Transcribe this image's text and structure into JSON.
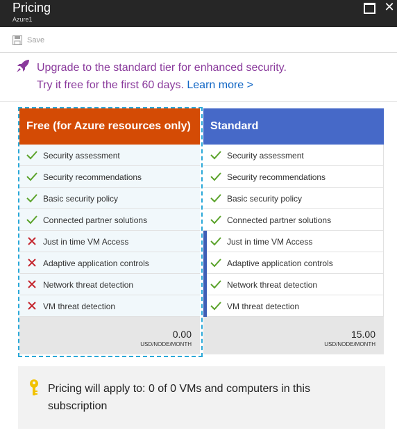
{
  "window": {
    "title": "Pricing",
    "subtitle": "Azure1"
  },
  "toolbar": {
    "save_label": "Save"
  },
  "banner": {
    "line1": "Upgrade to the standard tier for enhanced security.",
    "line2": "Try it free for the first 60 days.",
    "learn_more": "Learn more >",
    "accent_color": "#8a3a9c",
    "link_color": "#0f65c4"
  },
  "tiers": {
    "free": {
      "name": "Free (for Azure resources only)",
      "color": "#d44b05",
      "selected": true,
      "features": [
        {
          "label": "Security assessment",
          "included": true
        },
        {
          "label": "Security recommendations",
          "included": true
        },
        {
          "label": "Basic security policy",
          "included": true
        },
        {
          "label": "Connected partner solutions",
          "included": true
        },
        {
          "label": "Just in time VM Access",
          "included": false
        },
        {
          "label": "Adaptive application controls",
          "included": false
        },
        {
          "label": "Network threat detection",
          "included": false
        },
        {
          "label": "VM threat detection",
          "included": false
        }
      ],
      "price": "0.00",
      "unit": "USD/NODE/MONTH"
    },
    "standard": {
      "name": "Standard",
      "color": "#4669c8",
      "selected": false,
      "features": [
        {
          "label": "Security assessment",
          "included": true
        },
        {
          "label": "Security recommendations",
          "included": true
        },
        {
          "label": "Basic security policy",
          "included": true
        },
        {
          "label": "Connected partner solutions",
          "included": true
        },
        {
          "label": "Just in time VM Access",
          "included": true
        },
        {
          "label": "Adaptive application controls",
          "included": true
        },
        {
          "label": "Network threat detection",
          "included": true
        },
        {
          "label": "VM threat detection",
          "included": true
        }
      ],
      "price": "15.00",
      "unit": "USD/NODE/MONTH"
    }
  },
  "info": {
    "icon": "key-icon",
    "text": "Pricing will apply to: 0 of 0 VMs and computers in this subscription"
  }
}
